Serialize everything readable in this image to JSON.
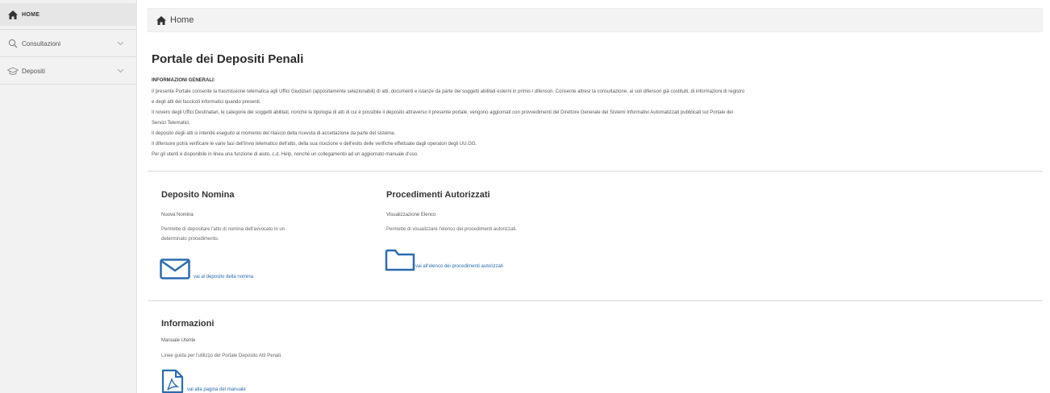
{
  "sidebar": {
    "items": [
      {
        "label": "HOME",
        "icon": "home-icon"
      },
      {
        "label": "Consultazioni",
        "icon": "search-icon"
      },
      {
        "label": "Depositi",
        "icon": "graduation-cap-icon"
      }
    ]
  },
  "breadcrumb": {
    "label": "Home"
  },
  "page": {
    "title": "Portale dei Depositi Penali",
    "info_heading": "INFORMAZIONI GENERALI:",
    "info_lines": [
      "Il presente Portale consente la trasmissione telematica agli Uffici Giudiziari (appositamente selezionabili) di atti, documenti e istanze da parte dei soggetti abilitati esterni in primis i difensori. Consente altresì la consultazione, ai soli difensori già costituiti, di informazioni di registro",
      "e degli atti dei fascicoli informatici quando presenti.",
      "Il novero degli Uffici Destinatari, le categorie dei soggetti abilitati, nonché la tipologia di atti di cui è possibile il deposito attraverso il presente portale, vengono aggiornati con provvedimenti del Direttore Generale dei Sistemi Informativi Automatizzati pubblicati sul Portale dei",
      "Servizi Telematici.",
      "Il deposito degli atti si intende eseguito al momento del rilascio della ricevuta di accettazione da parte del sistema.",
      "Il difensore potrà verificare le varie fasi dell'invio telematico dell'atto, della sua ricezione e dell'esito delle verifiche effettuate dagli operatori degli UU.GG.",
      "Per gli utenti è disponibile in linea una funzione di aiuto, c.d. Help, nonché un collegamento ad un aggiornato manuale d'uso."
    ]
  },
  "cards": {
    "nomina": {
      "title": "Deposito Nomina",
      "subtitle": "Nuova Nomina",
      "desc_line1": "Permette di depositare l'atto di nomina dell'avvocato in un",
      "desc_line2": "determinato procedimento.",
      "link": "vai al deposito della nomina",
      "icon": "envelope-icon"
    },
    "procedimenti": {
      "title": "Procedimenti Autorizzati",
      "subtitle": "Visualizzazione Elenco",
      "desc_line1": "Permette di visualizzare l'elenco dei procedimenti autorizzati.",
      "link": "vai all'elenco dei procedimenti autorizzati",
      "icon": "folder-icon"
    },
    "informazioni": {
      "title": "Informazioni",
      "subtitle": "Manuale Utente",
      "desc_line1": "Linee guida per l'utilizzo del Portale Deposito Atti Penali.",
      "link": "vai alla pagina del manuale",
      "icon": "pdf-file-icon"
    }
  },
  "colors": {
    "link": "#2a6bb0",
    "sidebar_bg": "#f2f2f2",
    "breadcrumb_bg": "#f3f3f3"
  }
}
